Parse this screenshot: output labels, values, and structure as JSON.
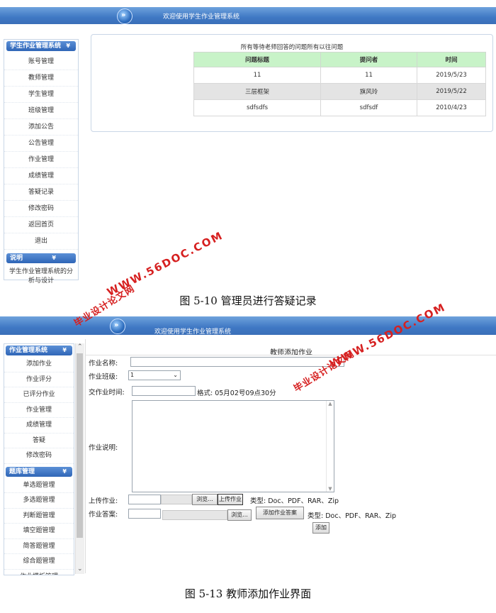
{
  "screen1": {
    "welcome": "欢迎使用学生作业管理系统",
    "sidebar_title": "学生作业管理系统",
    "menu": [
      "账号管理",
      "教师管理",
      "学生管理",
      "班级管理",
      "添加公告",
      "公告管理",
      "作业管理",
      "成绩管理",
      "答疑记录",
      "修改密码",
      "返回首页",
      "退出"
    ],
    "note_title": "说明",
    "note_text": "学生作业管理系统的分析与设计",
    "table_caption": "所有等待老师回答的问题所有以往问题",
    "columns": [
      "问题标题",
      "提问者",
      "时间"
    ],
    "rows": [
      [
        "11",
        "11",
        "2019/5/23"
      ],
      [
        "三层框架",
        "旗风玲",
        "2019/5/22"
      ],
      [
        "sdfsdfs",
        "sdfsdf",
        "2010/4/23"
      ]
    ],
    "figure_caption": "图 5-10    管理员进行答疑记录"
  },
  "screen2": {
    "welcome": "欢迎使用学生作业管理系统",
    "sidebar_title": "作业管理系统",
    "menu": [
      "添加作业",
      "作业评分",
      "已评分作业",
      "作业管理",
      "成绩管理",
      "答疑",
      "修改密码"
    ],
    "bank_title": "题库管理",
    "bank_menu": [
      "单选题管理",
      "多选题管理",
      "判断题管理",
      "填空题管理",
      "简答题管理",
      "综合题管理",
      "作业模板管理"
    ],
    "form_title": "教师添加作业",
    "labels": {
      "name": "作业名称:",
      "class": "作业班级:",
      "time": "交作业时间:",
      "time_hint": "格式: 05月02号09点30分",
      "desc": "作业说明:",
      "upload": "上传作业:",
      "answer": "作业答案:"
    },
    "class_value": "1",
    "browse": "浏览...",
    "upload_btn": "上传作业",
    "add_answer_btn": "添加作业答案",
    "types": "类型: Doc、PDF、RAR、Zip",
    "submit": "添加",
    "figure_caption": "图 5-13    教师添加作业界面"
  },
  "watermark": {
    "site": "WWW.56DOC.COM",
    "name": "毕业设计论文网"
  }
}
